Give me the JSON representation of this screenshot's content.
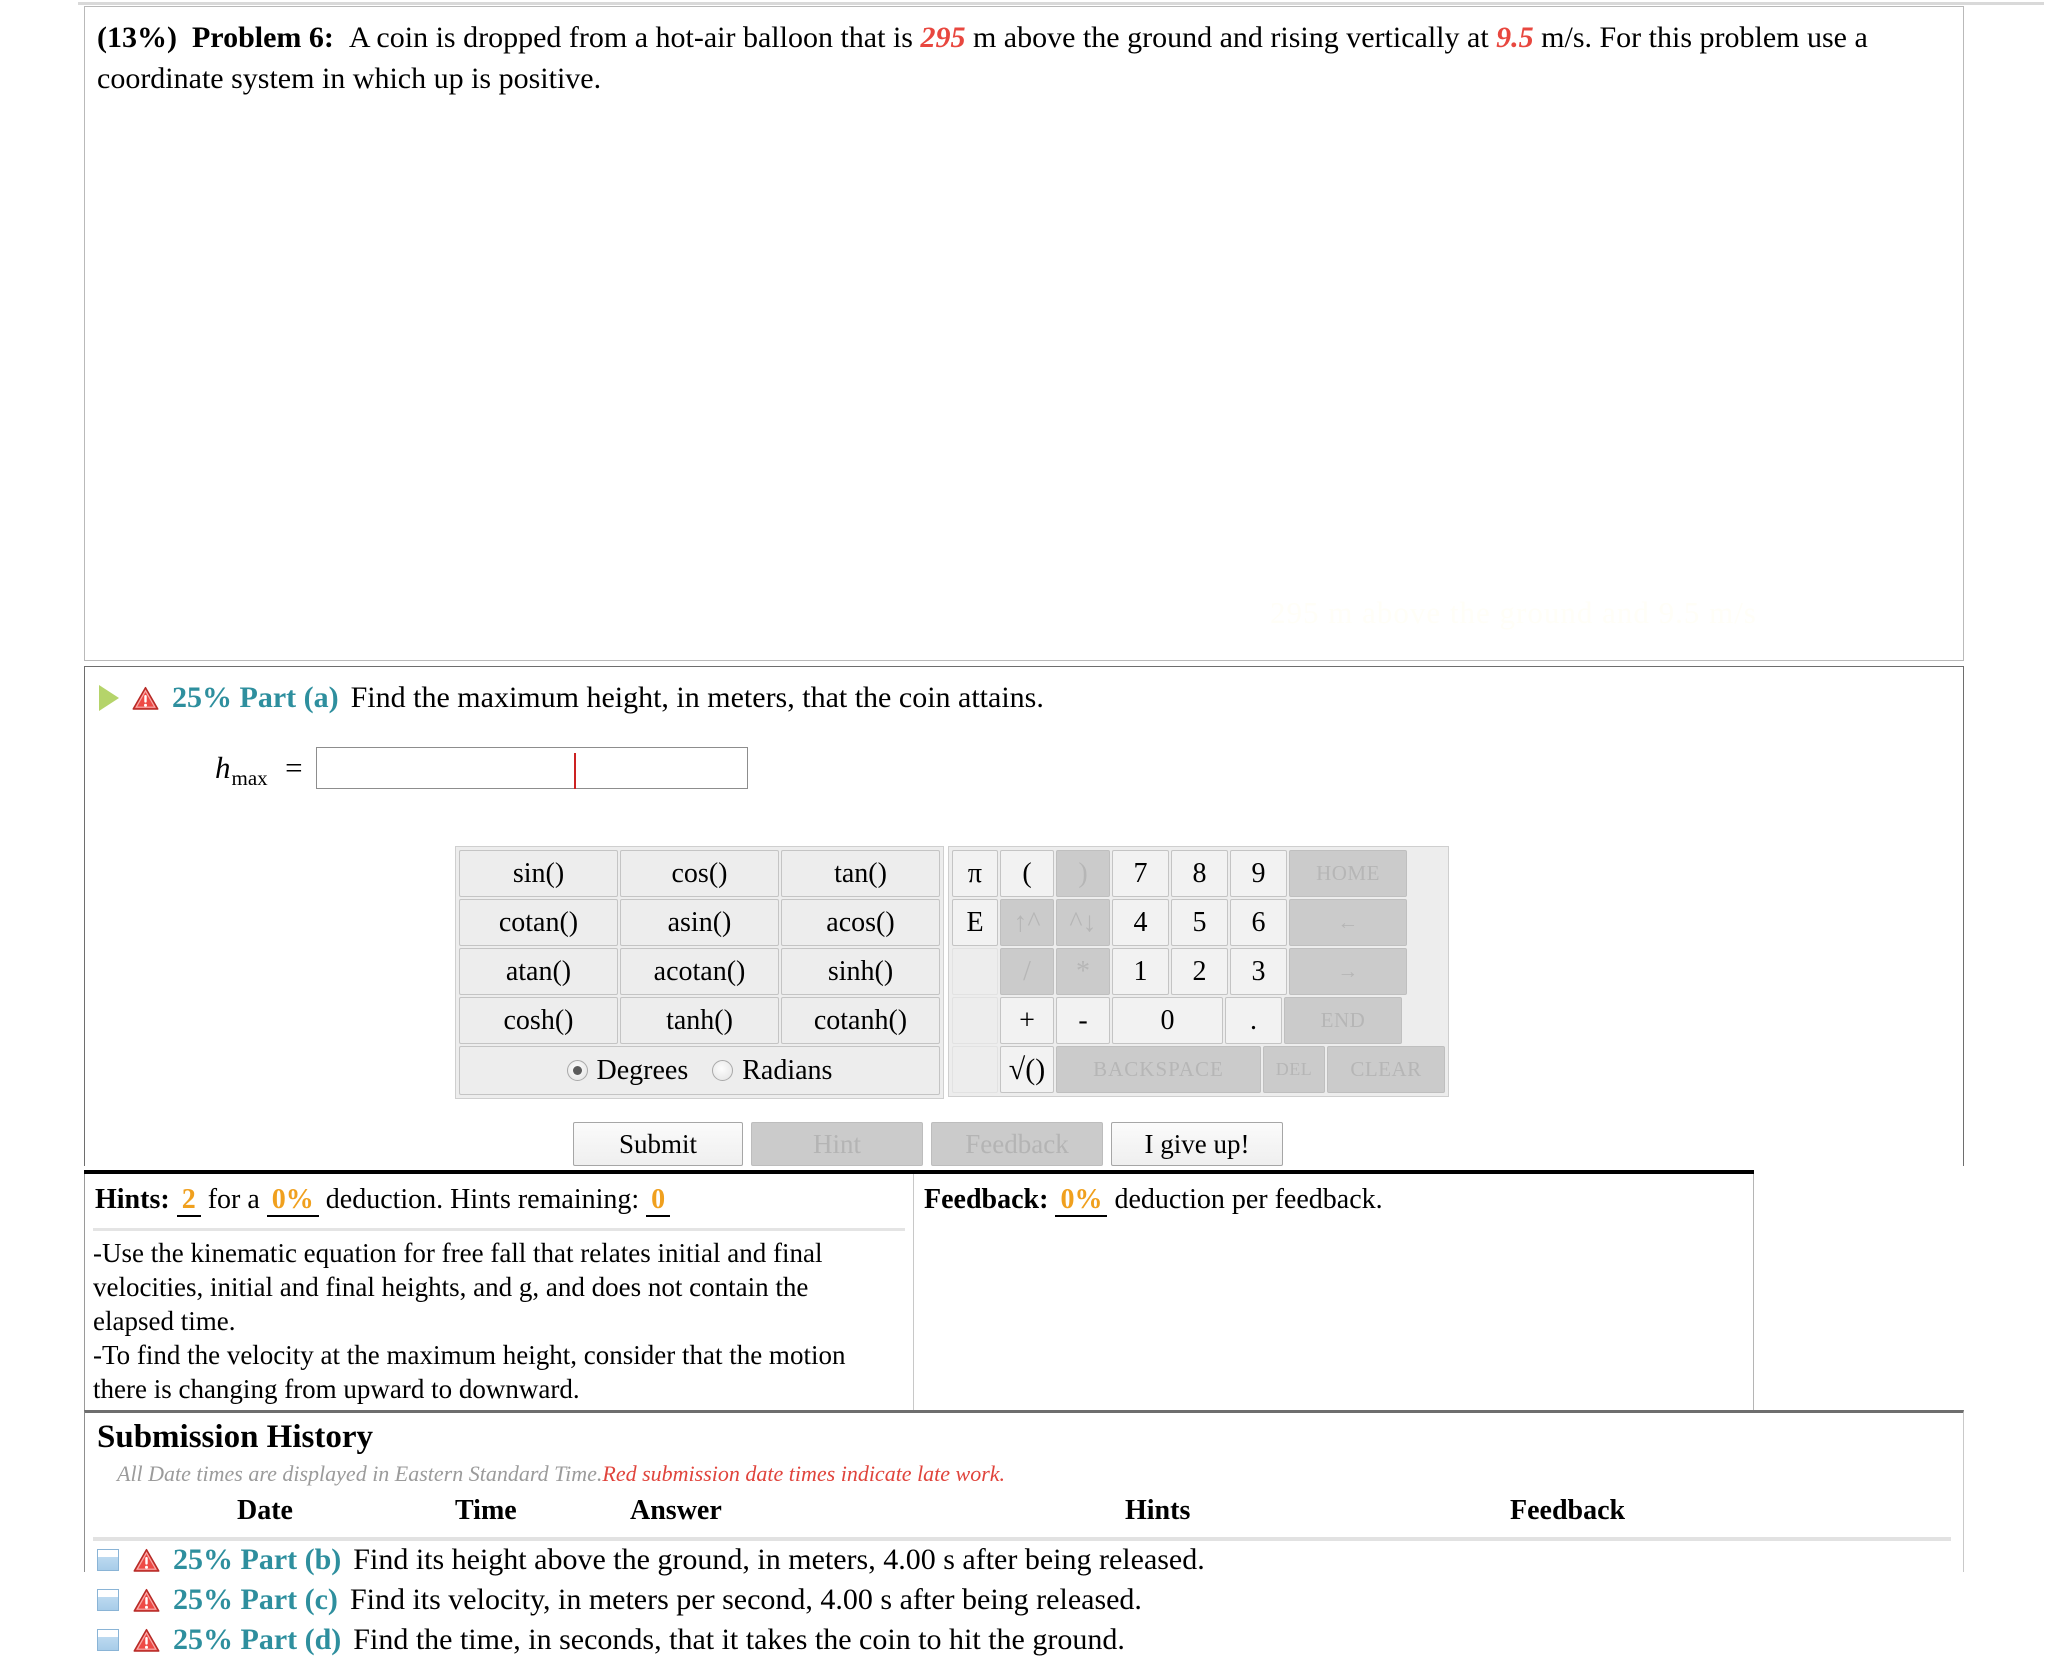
{
  "problem": {
    "percent": "(13%)",
    "label": "Problem 6:",
    "text_1": "A coin is dropped from a hot-air balloon that is",
    "value_height": "295",
    "text_2": "m above the ground and rising vertically at",
    "value_speed": "9.5",
    "text_3": "m/s. For this problem use a coordinate system in which up is positive.",
    "watermark": "295 m above the ground and 9.5 m/s"
  },
  "part_a": {
    "percent": "25% Part (a)",
    "description": "Find the maximum height, in meters, that the coin attains.",
    "answer_label": "h",
    "answer_sub": "max",
    "equals": "=",
    "answer_value": "",
    "answer_placeholder": ""
  },
  "calculator": {
    "trig_rows": [
      [
        "sin()",
        "cos()",
        "tan()"
      ],
      [
        "cotan()",
        "asin()",
        "acos()"
      ],
      [
        "atan()",
        "acotan()",
        "sinh()"
      ],
      [
        "cosh()",
        "tanh()",
        "cotanh()"
      ]
    ],
    "angle_mode": {
      "degrees_label": "Degrees",
      "radians_label": "Radians",
      "selected": "Degrees"
    },
    "num_rows": [
      [
        {
          "label": "π",
          "w": "w1",
          "disabled": false,
          "name": "pi"
        },
        {
          "label": "(",
          "w": "w2",
          "disabled": false,
          "name": "open-paren"
        },
        {
          "label": ")",
          "w": "w2",
          "disabled": true,
          "name": "close-paren"
        },
        {
          "label": "7",
          "w": "w3",
          "disabled": false,
          "name": "7"
        },
        {
          "label": "8",
          "w": "w3",
          "disabled": false,
          "name": "8"
        },
        {
          "label": "9",
          "w": "w3",
          "disabled": false,
          "name": "9"
        },
        {
          "label": "HOME",
          "w": "cmd",
          "disabled": true,
          "name": "home"
        }
      ],
      [
        {
          "label": "E",
          "w": "w1",
          "disabled": false,
          "name": "exponent-e"
        },
        {
          "label": "↑^",
          "w": "w2",
          "disabled": true,
          "name": "power-up"
        },
        {
          "label": "^↓",
          "w": "w2",
          "disabled": true,
          "name": "power-down"
        },
        {
          "label": "4",
          "w": "w3",
          "disabled": false,
          "name": "4"
        },
        {
          "label": "5",
          "w": "w3",
          "disabled": false,
          "name": "5"
        },
        {
          "label": "6",
          "w": "w3",
          "disabled": false,
          "name": "6"
        },
        {
          "label": "←",
          "w": "cmd",
          "disabled": true,
          "name": "arrow-left"
        }
      ],
      [
        {
          "label": "",
          "w": "w1",
          "disabled": false,
          "blank": true,
          "name": "blank-1"
        },
        {
          "label": "/",
          "w": "w2",
          "disabled": true,
          "name": "divide"
        },
        {
          "label": "*",
          "w": "w2",
          "disabled": true,
          "name": "multiply"
        },
        {
          "label": "1",
          "w": "w3",
          "disabled": false,
          "name": "1"
        },
        {
          "label": "2",
          "w": "w3",
          "disabled": false,
          "name": "2"
        },
        {
          "label": "3",
          "w": "w3",
          "disabled": false,
          "name": "3"
        },
        {
          "label": "→",
          "w": "cmd",
          "disabled": true,
          "name": "arrow-right"
        }
      ],
      [
        {
          "label": "",
          "w": "w1",
          "disabled": false,
          "blank": true,
          "name": "blank-2"
        },
        {
          "label": "+",
          "w": "w2",
          "disabled": false,
          "name": "plus"
        },
        {
          "label": "-",
          "w": "w2",
          "disabled": false,
          "name": "minus"
        },
        {
          "label": "0",
          "w": "wide",
          "disabled": false,
          "name": "0"
        },
        {
          "label": ".",
          "w": "w3",
          "disabled": false,
          "name": "decimal-point"
        },
        {
          "label": "END",
          "w": "cmd",
          "disabled": true,
          "name": "end"
        }
      ],
      [
        {
          "label": "",
          "w": "w1",
          "disabled": false,
          "blank": true,
          "name": "blank-3"
        },
        {
          "label": "√()",
          "w": "w2",
          "disabled": false,
          "name": "square-root"
        },
        {
          "label": "BACKSPACE",
          "w": "back",
          "disabled": true,
          "name": "backspace"
        },
        {
          "label": "DEL",
          "w": "del",
          "disabled": true,
          "name": "delete"
        },
        {
          "label": "CLEAR",
          "w": "cmd",
          "disabled": true,
          "name": "clear"
        }
      ]
    ]
  },
  "actions": {
    "submit": "Submit",
    "hint": "Hint",
    "feedback": "Feedback",
    "give_up": "I give up!"
  },
  "hints": {
    "title": "Hints:",
    "count": "2",
    "for_a": "for a",
    "deduction_pct": "0%",
    "deduction_text": "deduction. Hints remaining:",
    "remaining": "0",
    "body_line_1": "-Use the kinematic equation for free fall that relates initial and final velocities, initial and final heights, and g, and does not contain the elapsed time.",
    "body_line_2": "-To find the velocity at the maximum height, consider that the motion there is changing from upward to downward."
  },
  "feedback": {
    "title": "Feedback:",
    "deduction_pct": "0%",
    "deduction_text": "deduction per feedback."
  },
  "submission_history": {
    "title": "Submission History",
    "note_gray": "All Date times are displayed in Eastern Standard Time.",
    "note_red": "Red submission date times indicate late work.",
    "columns": [
      "Date",
      "Time",
      "Answer",
      "Hints",
      "Feedback"
    ],
    "rows": []
  },
  "collapsed_parts": [
    {
      "percent": "25% Part (b)",
      "description": "Find its height above the ground, in meters, 4.00 s after being released."
    },
    {
      "percent": "25% Part (c)",
      "description": "Find its velocity, in meters per second, 4.00 s after being released."
    },
    {
      "percent": "25% Part (d)",
      "description": "Find the time, in seconds, that it takes the coin to hit the ground."
    }
  ],
  "colors": {
    "part_heading": "#2e8f9e",
    "value_red": "#e8473f",
    "orange_value": "#f0a01e",
    "late_red": "#e0443c"
  }
}
